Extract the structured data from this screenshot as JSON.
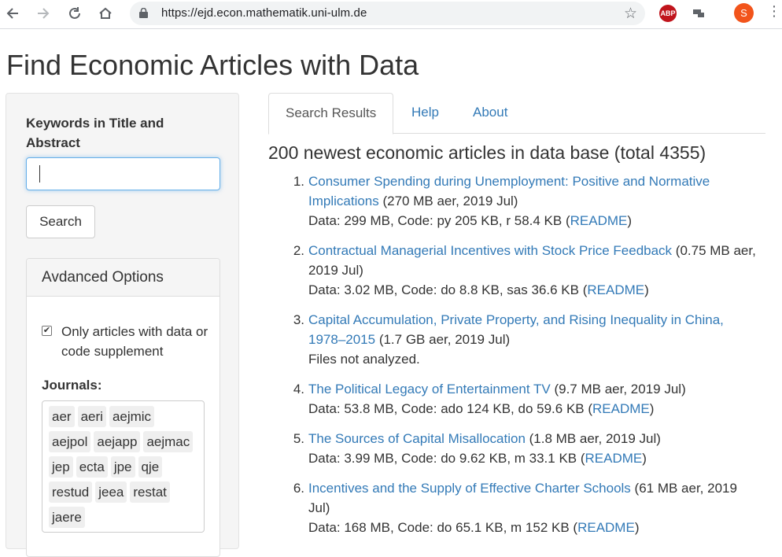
{
  "browser": {
    "url": "https://ejd.econ.mathematik.uni-ulm.de",
    "profile_initial": "S",
    "abp_label": "ABP",
    "icons": [
      "back-arrow-icon",
      "forward-arrow-icon",
      "reload-icon",
      "home-icon",
      "lock-icon",
      "bookmark-star-icon",
      "adblock-icon",
      "extension-icon",
      "menu-dots-icon"
    ]
  },
  "page": {
    "title": "Find Economic Articles with Data"
  },
  "sidebar": {
    "keywords_label": "Keywords in Title and Abstract",
    "keywords_value": "",
    "search_button": "Search",
    "advanced": {
      "heading": "Avdanced Options",
      "only_data_label": "Only articles with data or code supplement",
      "only_data_checked": true,
      "journals_label": "Journals:",
      "journals": [
        "aer",
        "aeri",
        "aejmic",
        "aejpol",
        "aejapp",
        "aejmac",
        "jep",
        "ecta",
        "jpe",
        "qje",
        "restud",
        "jeea",
        "restat",
        "jaere"
      ]
    }
  },
  "tabs": [
    {
      "label": "Search Results",
      "active": true
    },
    {
      "label": "Help",
      "active": false
    },
    {
      "label": "About",
      "active": false
    }
  ],
  "results": {
    "heading": "200 newest economic articles in data base (total 4355)",
    "readme_label": "README",
    "items": [
      {
        "num": "1.",
        "title": "Consumer Spending during Unemployment: Positive and Normative Implications",
        "meta": " (270 MB aer, 2019 Jul)",
        "data": "Data: 299 MB, Code: py 205 KB, r 58.4 KB (",
        "has_readme": true
      },
      {
        "num": "2.",
        "title": "Contractual Managerial Incentives with Stock Price Feedback",
        "meta": " (0.75 MB aer, 2019 Jul)",
        "data": "Data: 3.02 MB, Code: do 8.8 KB, sas 36.6 KB (",
        "has_readme": true
      },
      {
        "num": "3.",
        "title": "Capital Accumulation, Private Property, and Rising Inequality in China, 1978–2015",
        "meta": " (1.7 GB aer, 2019 Jul)",
        "data": "Files not analyzed.",
        "has_readme": false
      },
      {
        "num": "4.",
        "title": "The Political Legacy of Entertainment TV",
        "meta": " (9.7 MB aer, 2019 Jul)",
        "data": "Data: 53.8 MB, Code: ado 124 KB, do 59.6 KB (",
        "has_readme": true
      },
      {
        "num": "5.",
        "title": "The Sources of Capital Misallocation",
        "meta": " (1.8 MB aer, 2019 Jul)",
        "data": "Data: 3.99 MB, Code: do 9.62 KB, m 33.1 KB (",
        "has_readme": true
      },
      {
        "num": "6.",
        "title": "Incentives and the Supply of Effective Charter Schools",
        "meta": " (61 MB aer, 2019 Jul)",
        "data": "Data: 168 MB, Code: do 65.1 KB, m 152 KB (",
        "has_readme": true
      }
    ]
  }
}
